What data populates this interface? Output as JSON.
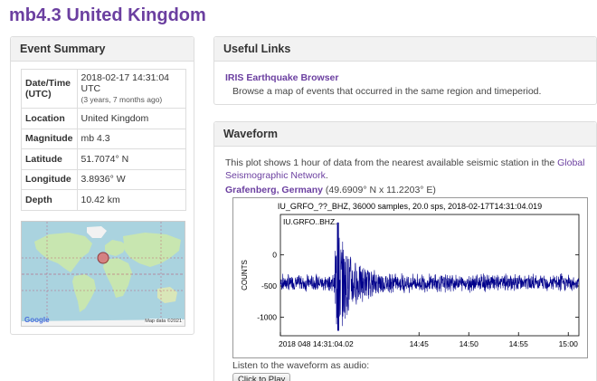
{
  "page": {
    "title": "mb4.3 United Kingdom"
  },
  "summary": {
    "heading": "Event Summary",
    "rows": [
      {
        "key": "Date/Time (UTC)",
        "value": "2018-02-17 14:31:04 UTC",
        "sub": "(3 years, 7 months ago)"
      },
      {
        "key": "Location",
        "value": "United Kingdom"
      },
      {
        "key": "Magnitude",
        "value": "mb 4.3"
      },
      {
        "key": "Latitude",
        "value": "51.7074° N"
      },
      {
        "key": "Longitude",
        "value": "3.8936° W"
      },
      {
        "key": "Depth",
        "value": "10.42 km"
      }
    ],
    "map": {
      "logo": "Google",
      "credit": "Map data ©2021"
    }
  },
  "links": {
    "heading": "Useful Links",
    "title": "IRIS Earthquake Browser",
    "description": "Browse a map of events that occurred in the same region and timeperiod."
  },
  "waveform": {
    "heading": "Waveform",
    "text_pre": "This plot shows 1 hour of data from the nearest available seismic station in the ",
    "text_link": "Global Seismographic Network",
    "text_post": ".",
    "station": "Grafenberg, Germany",
    "station_coords": " (49.6909° N x 11.2203° E)",
    "listen": "Listen to the waveform as audio:",
    "play": "Click to Play"
  },
  "chart_data": {
    "type": "line",
    "title": "IU_GRFO_??_BHZ, 36000 samples, 20.0 sps, 2018-02-17T14:31:04.019",
    "trace_label": "IU.GRFO..BHZ.",
    "ylabel": "COUNTS",
    "yticks": [
      0,
      -500,
      -1000
    ],
    "ylim": [
      -1300,
      650
    ],
    "xticks": [
      "2018 048 14:31:04.02",
      "14:45",
      "14:50",
      "14:55",
      "15:00"
    ],
    "xtick_minutes": [
      0,
      13.93,
      18.93,
      23.93,
      28.93
    ],
    "xlim_minutes": [
      0,
      30
    ],
    "baseline": -450,
    "event_minute": 5.8,
    "event_peak_max": 520,
    "event_peak_min": -1220,
    "noise_amplitude": 120,
    "color": "#00008b"
  }
}
